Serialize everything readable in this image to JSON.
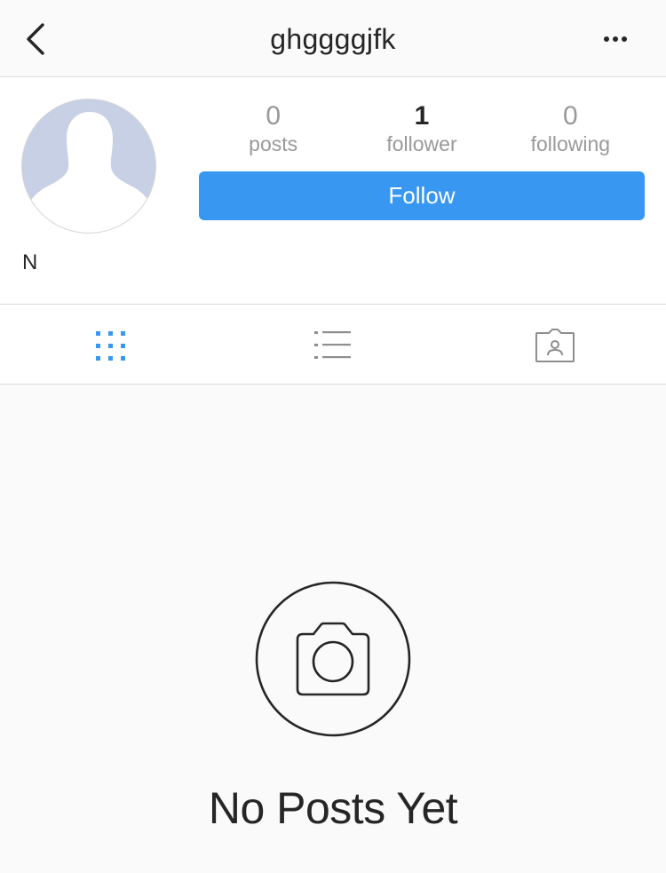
{
  "nav": {
    "back_icon": "chevron-left-icon",
    "title": "ghggggjfk",
    "more_icon": "more-horizontal-icon"
  },
  "profile": {
    "avatar_icon": "default-avatar-silhouette",
    "stats": [
      {
        "count": "0",
        "label": "posts"
      },
      {
        "count": "1",
        "label": "follower"
      },
      {
        "count": "0",
        "label": "following"
      }
    ],
    "follow_label": "Follow",
    "display_name": "N"
  },
  "tabs": [
    {
      "icon": "grid-icon",
      "active": true
    },
    {
      "icon": "list-icon",
      "active": false
    },
    {
      "icon": "tagged-icon",
      "active": false
    }
  ],
  "empty_state": {
    "icon": "camera-icon",
    "title": "No Posts Yet"
  },
  "colors": {
    "accent": "#3897f0",
    "text": "#262626",
    "muted": "#999999",
    "border": "#dbdbdb",
    "avatar_bg": "#c7d0e4"
  }
}
